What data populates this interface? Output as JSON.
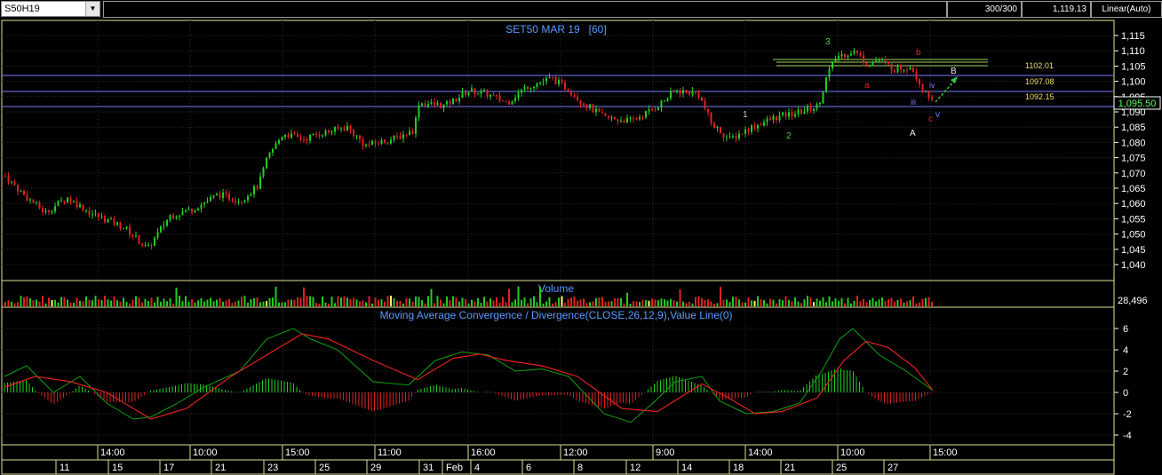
{
  "toolbar": {
    "symbol": "S50H19",
    "bars_count": "300/300",
    "last_value": "1,119.13",
    "scale_mode": "Linear(Auto)"
  },
  "main_panel": {
    "title": "SET50 MAR 19   [60]",
    "price_axis_labels": [
      "1,115",
      "1,110",
      "1,105",
      "1,100",
      "1,095",
      "1,090",
      "1,085",
      "1,080",
      "1,075",
      "1,070",
      "1,065",
      "1,060",
      "1,055",
      "1,050",
      "1,045",
      "1,040"
    ],
    "current_price": "1,095.50",
    "level_labels": [
      "1102.01",
      "1097.08",
      "1092.15"
    ],
    "wave_labels": {
      "w1": "1",
      "w2": "2",
      "w3": "3",
      "a_small": "a",
      "b_small": "b",
      "c_small": "c",
      "iii": "iii",
      "iv": "iv",
      "v": "v",
      "A": "A",
      "B": "B"
    }
  },
  "volume_panel": {
    "title": "Volume",
    "last_value": "28,496"
  },
  "macd_panel": {
    "title": "Moving Average Convergence / Divergence(CLOSE,26,12,9),Value Line(0)",
    "axis_labels": [
      "6",
      "4",
      "2",
      "0",
      "-2",
      "-4"
    ]
  },
  "time_axis": {
    "hour_labels": [
      "14:00",
      "10:00",
      "15:00",
      "11:00",
      "16:00",
      "12:00",
      "9:00",
      "14:00",
      "10:00",
      "15:00"
    ],
    "date_labels": [
      "11",
      "15",
      "17",
      "21",
      "23",
      "25",
      "29",
      "31",
      "Feb",
      "4",
      "6",
      "8",
      "12",
      "14",
      "18",
      "21",
      "25",
      "27"
    ]
  },
  "colors": {
    "up": "#22cc22",
    "down": "#dd2222",
    "title": "#5b9bff",
    "level_line": "#7a7aff",
    "panel_border": "#e0e090",
    "macd_line": "#10a010",
    "signal_line": "#e02020"
  }
}
